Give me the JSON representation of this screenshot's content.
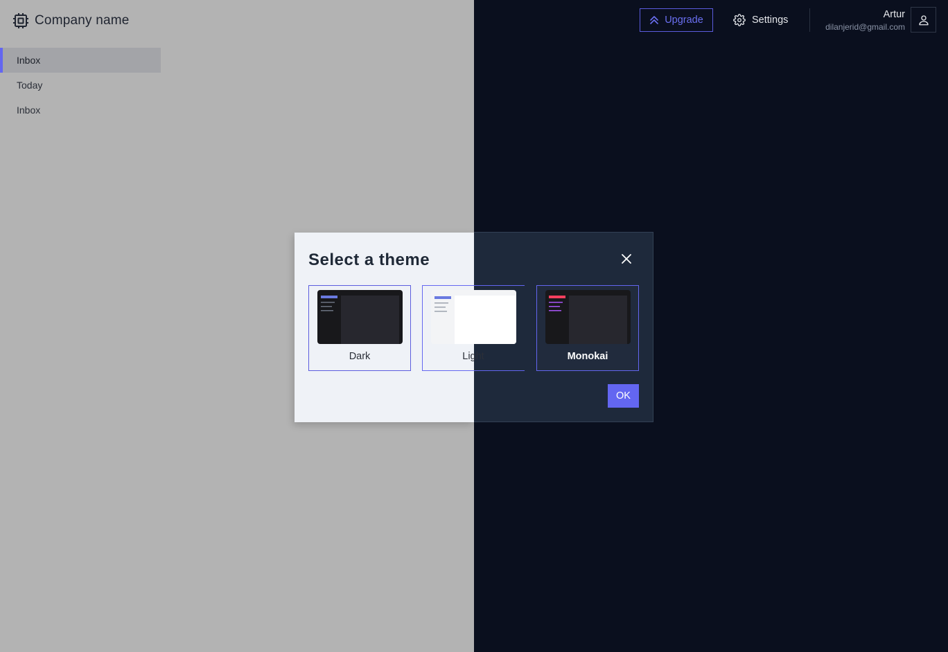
{
  "brand": {
    "name": "Company name",
    "icon": "cpu-chip-icon"
  },
  "sidebar": {
    "items": [
      {
        "label": "Inbox",
        "active": true
      },
      {
        "label": "Today",
        "active": false
      },
      {
        "label": "Inbox",
        "active": false
      }
    ]
  },
  "header": {
    "upgrade_label": "Upgrade",
    "upgrade_icon": "chevrons-up-icon",
    "settings_label": "Settings",
    "settings_icon": "gear-icon",
    "user_name": "Artur",
    "user_email": "dilanjerid@gmail.com",
    "avatar_icon": "user-icon"
  },
  "modal": {
    "title": "Select a theme",
    "close_icon": "close-icon",
    "themes": [
      {
        "label": "Dark"
      },
      {
        "label": "Light"
      },
      {
        "label": "Monokai",
        "selected": true
      }
    ],
    "ok_label": "OK"
  },
  "colors": {
    "accent": "#6366f1",
    "dark_bg": "#0a0f1e",
    "light_bg": "#b3b3b3",
    "monokai_accent": "#f43f5e",
    "monokai_lines": "#a855f7"
  }
}
